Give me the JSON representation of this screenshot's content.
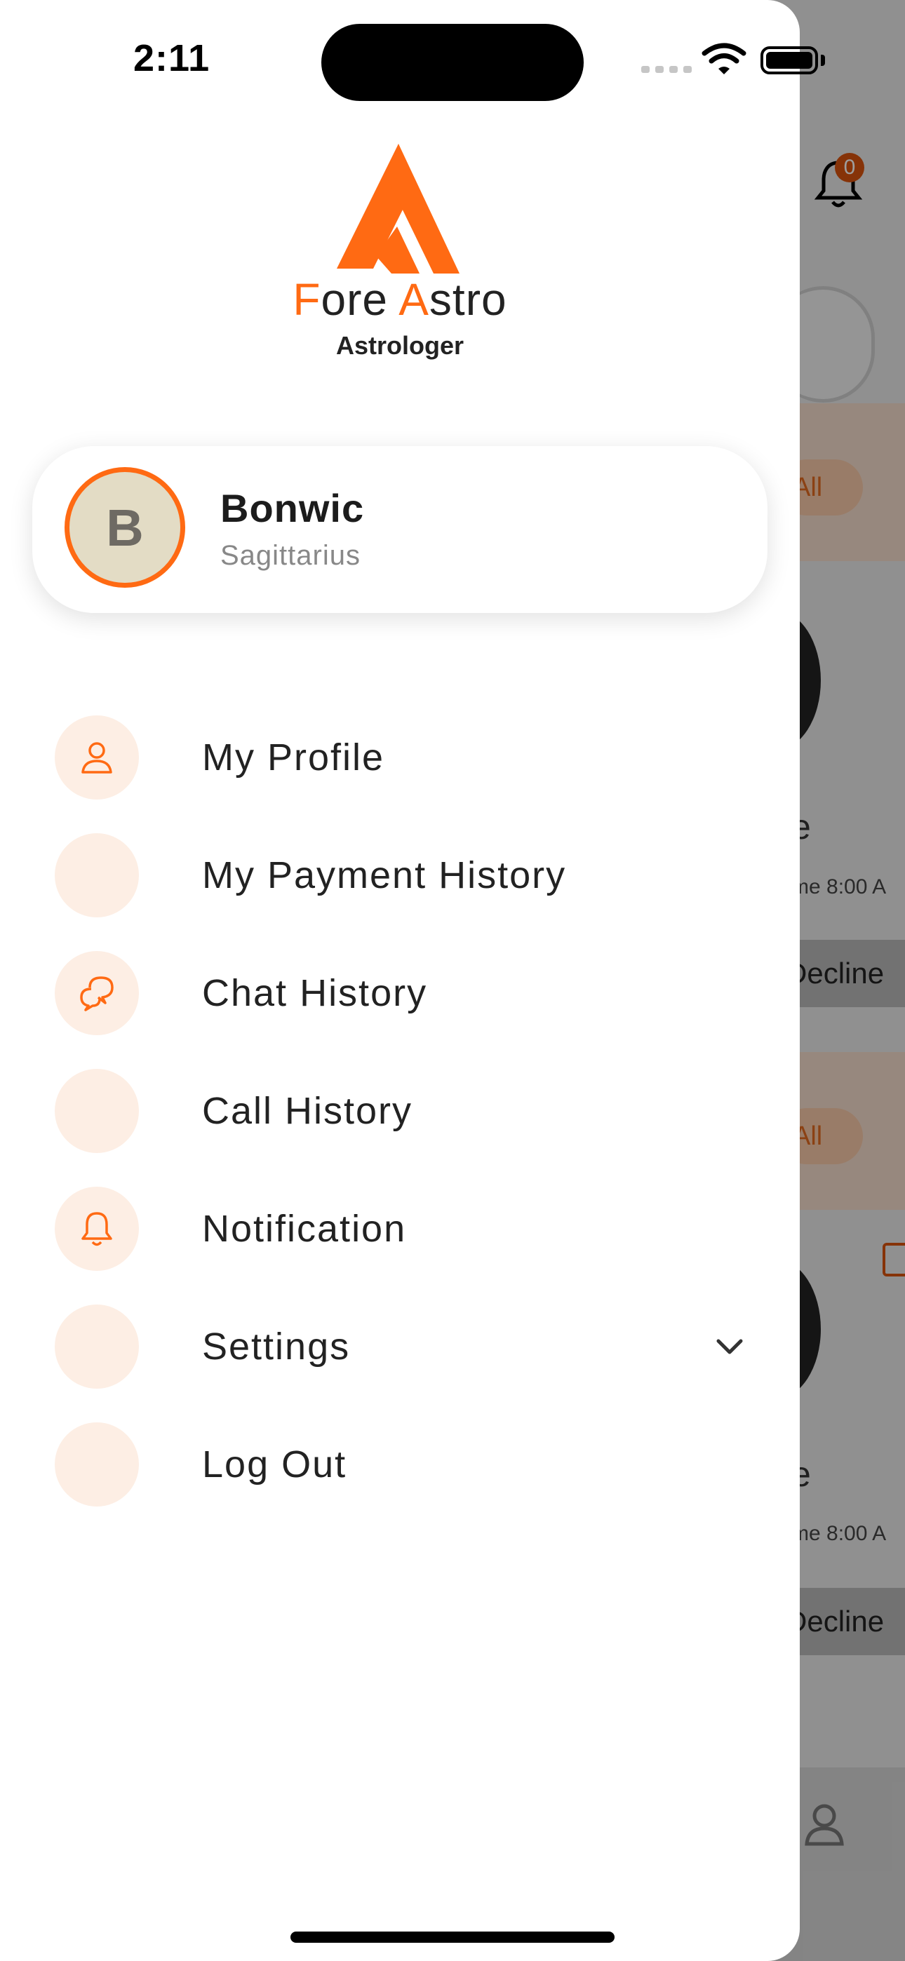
{
  "status_bar": {
    "time": "2:11"
  },
  "header": {
    "notification_count": "0"
  },
  "logo": {
    "brand_first": "F",
    "brand_rest1": "ore ",
    "brand_second": "A",
    "brand_rest2": "stro",
    "subtitle": "Astrologer"
  },
  "profile": {
    "initial": "B",
    "name": "Bonwic",
    "zodiac": "Sagittarius"
  },
  "menu": [
    {
      "label": "My Profile",
      "icon": "user-icon"
    },
    {
      "label": "My Payment History",
      "icon": ""
    },
    {
      "label": "Chat History",
      "icon": "chat-icon"
    },
    {
      "label": "Call History",
      "icon": ""
    },
    {
      "label": "Notification",
      "icon": "bell-icon"
    },
    {
      "label": "Settings",
      "icon": "",
      "expandable": true
    },
    {
      "label": "Log Out",
      "icon": ""
    }
  ],
  "background": {
    "filter_all_label": "All",
    "card_name_fragment": "e",
    "card_time_fragment": "me 8:00 A",
    "decline_label_fragment": "ecline"
  },
  "colors": {
    "accent": "#ff6a13",
    "icon_bg": "#fdeee4",
    "text": "#222222"
  }
}
